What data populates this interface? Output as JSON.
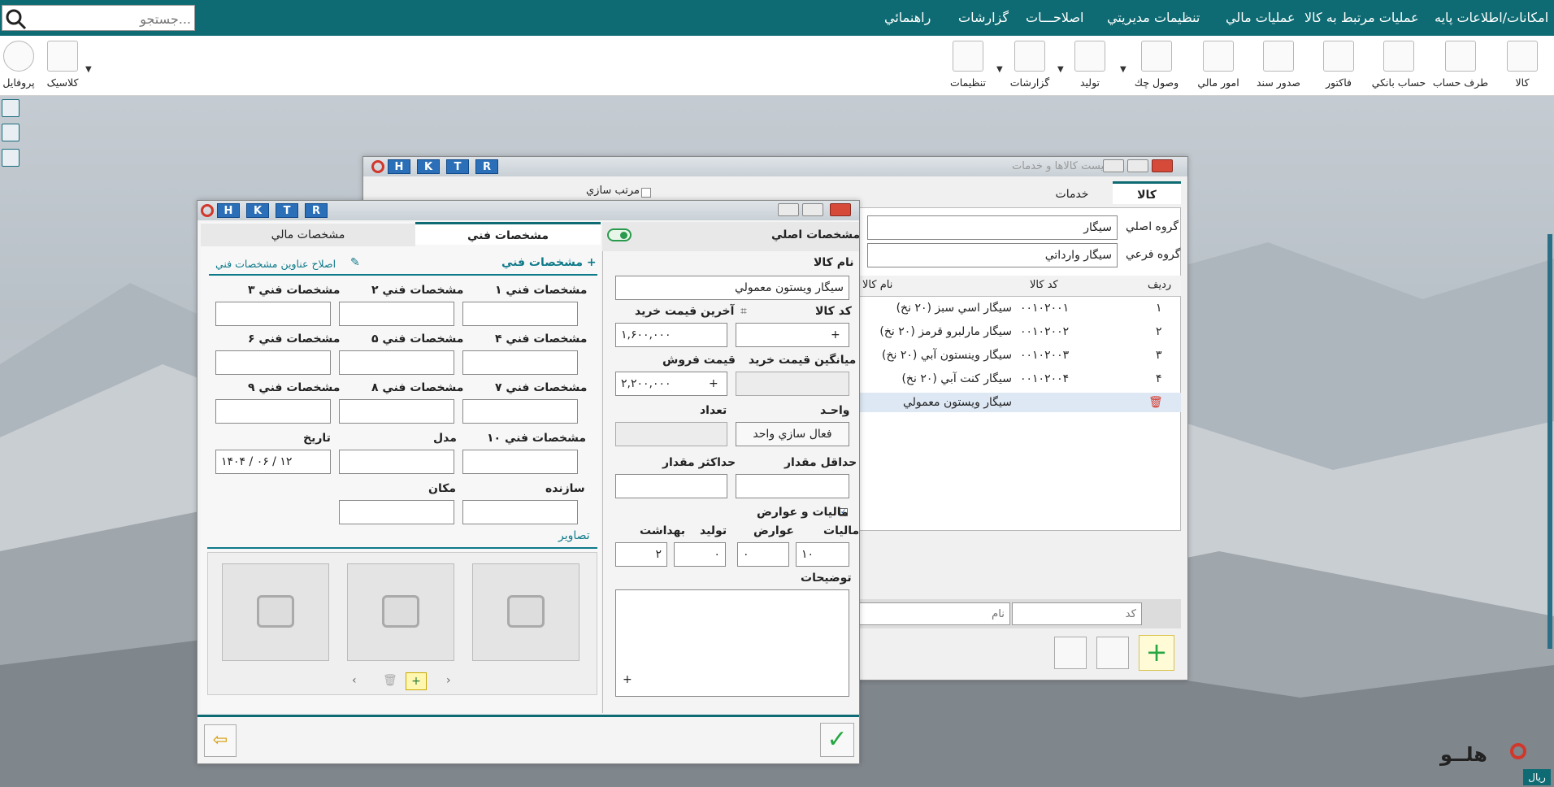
{
  "topbar": {
    "menu": [
      "امکانات/اطلاعات پايه",
      "عمليات مرتبط به کالا",
      "عمليات مالي",
      "تنظيمات مديريتي",
      "اصلاحـــات",
      "گزارشات",
      "راهنمائي"
    ],
    "search_placeholder": "جستجو..."
  },
  "toolbar": {
    "items": [
      "کالا",
      "طرف حساب",
      "حساب بانکي",
      "فاکتور",
      "صدور سند",
      "امور مالي",
      "وصول چك",
      "توليد",
      "گزارشات",
      "تنظيمات"
    ],
    "right_items": [
      "کلاسيک",
      "پروفايل"
    ]
  },
  "back_window": {
    "title": "ليست کالاها و خدمات",
    "hk": [
      "H",
      "K",
      "T",
      "R"
    ],
    "sort_label": "مرتب سازي",
    "tabs": [
      "کالا",
      "خدمات"
    ],
    "main_group_label": "گروه اصلي",
    "main_group_value": "سيگار",
    "sub_group_label": "گروه فرعي",
    "sub_group_value": "سيگار وارداتي",
    "columns": [
      "رديف",
      "کد کالا",
      "نام کالا"
    ],
    "rows": [
      {
        "n": "۱",
        "code": "۰۰۱۰۲۰۰۱",
        "name": "سيگار اسي سبز (۲۰ نخ)"
      },
      {
        "n": "۲",
        "code": "۰۰۱۰۲۰۰۲",
        "name": "سيگار مارلبرو قرمز (۲۰ نخ)"
      },
      {
        "n": "۳",
        "code": "۰۰۱۰۲۰۰۳",
        "name": "سيگار وينستون آبي (۲۰ نخ)"
      },
      {
        "n": "۴",
        "code": "۰۰۱۰۲۰۰۴",
        "name": "سيگار کنت آبي (۲۰ نخ)"
      },
      {
        "n": "",
        "code": "",
        "name": "سيگار ويستون معمولي"
      }
    ],
    "filter_code_placeholder": "کد",
    "filter_name_placeholder": "نام"
  },
  "form": {
    "hk": [
      "H",
      "K",
      "T",
      "R"
    ],
    "main_specs_title": "مشخصات اصلي",
    "name_label": "نام کالا",
    "name_value": "سيگار ويستون معمولي",
    "code_label": "کد کالا",
    "last_buy_label": "آخرين قيمت خريد",
    "last_buy_value": "۱,۶۰۰,۰۰۰",
    "avg_buy_label": "ميانگين قيمت خريد",
    "sell_label": "قيمت فروش",
    "sell_value": "۲,۲۰۰,۰۰۰",
    "unit_label": "واحـد",
    "unit_button": "فعال سازي واحد",
    "count_label": "تعداد",
    "min_label": "حداقل مقدار",
    "max_label": "حداکثر مقدار",
    "tax_check_label": "ماليات و عوارض",
    "tax_label": "ماليات",
    "tax_value": "۱۰",
    "duty_label": "عوارض",
    "duty_value": "۰",
    "prod_label": "توليد",
    "prod_value": "۰",
    "health_label": "بهداشت",
    "health_value": "۲",
    "desc_label": "توضيحات",
    "tabs": [
      "مشخصات فني",
      "مشخصات مالي"
    ],
    "tech_add": "مشخصات فني +",
    "tech_edit": "اصلاح عناوين مشخصات فني",
    "tech_fields": [
      "مشخصات فني ۱",
      "مشخصات فني ۲",
      "مشخصات فني ۳",
      "مشخصات فني ۴",
      "مشخصات فني ۵",
      "مشخصات فني ۶",
      "مشخصات فني ۷",
      "مشخصات فني ۸",
      "مشخصات فني ۹",
      "مشخصات فني ۱۰"
    ],
    "model_label": "مدل",
    "date_label": "تاريخ",
    "date_value": "۱۴۰۴ / ۰۶ / ۱۲",
    "maker_label": "سازنده",
    "place_label": "مکان",
    "images_label": "تصاوير"
  },
  "brand": {
    "logo_text": "هلــو",
    "currency": "ريال"
  }
}
